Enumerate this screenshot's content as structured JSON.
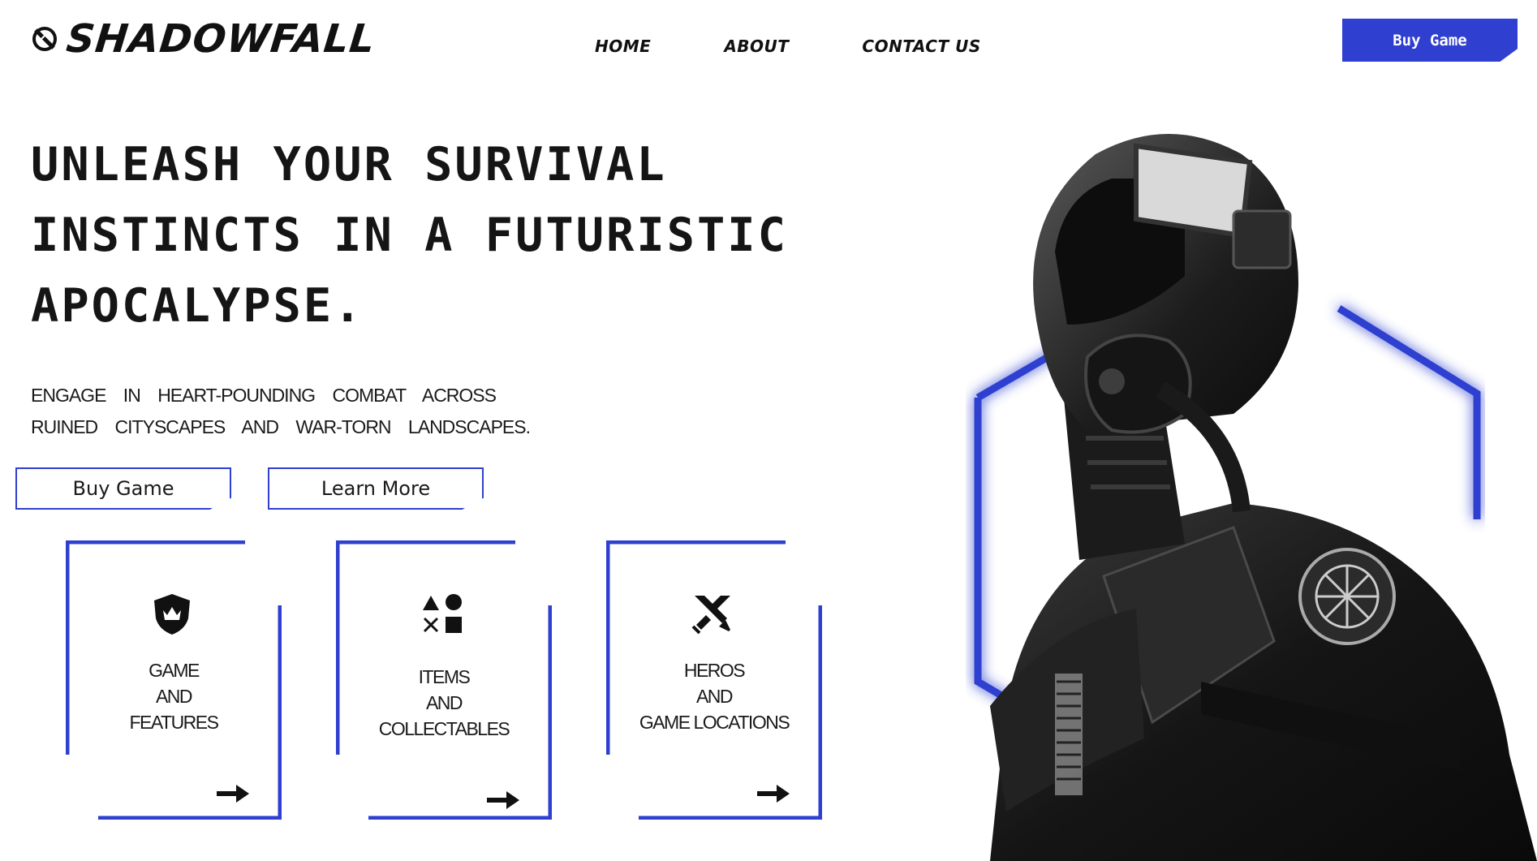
{
  "header": {
    "logo_text": "SHADOWFALL",
    "logo_icon": "helmet-icon",
    "nav": [
      {
        "label": "HOME"
      },
      {
        "label": "ABOUT"
      },
      {
        "label": "CONTACT US"
      }
    ],
    "cta_label": "Buy Game"
  },
  "hero": {
    "title": "UNLEASH YOUR SURVIVAL INSTINCTS IN A FUTURISTIC APOCALYPSE.",
    "subtitle": "ENGAGE IN HEART-POUNDING COMBAT ACROSS RUINED CITYSCAPES AND WAR-TORN LANDSCAPES.",
    "buy_label": "Buy Game",
    "learn_label": "Learn More"
  },
  "cards": [
    {
      "label": "GAME\nAND\nFEATURES",
      "icon": "crown-shield-icon",
      "arrow": "arrow-right-icon"
    },
    {
      "label": "ITEMS\nAND\nCOLLECTABLES",
      "icon": "shapes-icon",
      "arrow": "arrow-right-icon"
    },
    {
      "label": "HEROS\nAND\nGAME LOCATIONS",
      "icon": "crossed-swords-icon",
      "arrow": "arrow-right-icon"
    }
  ],
  "colors": {
    "accent": "#2f3fcf",
    "text": "#151515",
    "background": "#ffffff"
  }
}
